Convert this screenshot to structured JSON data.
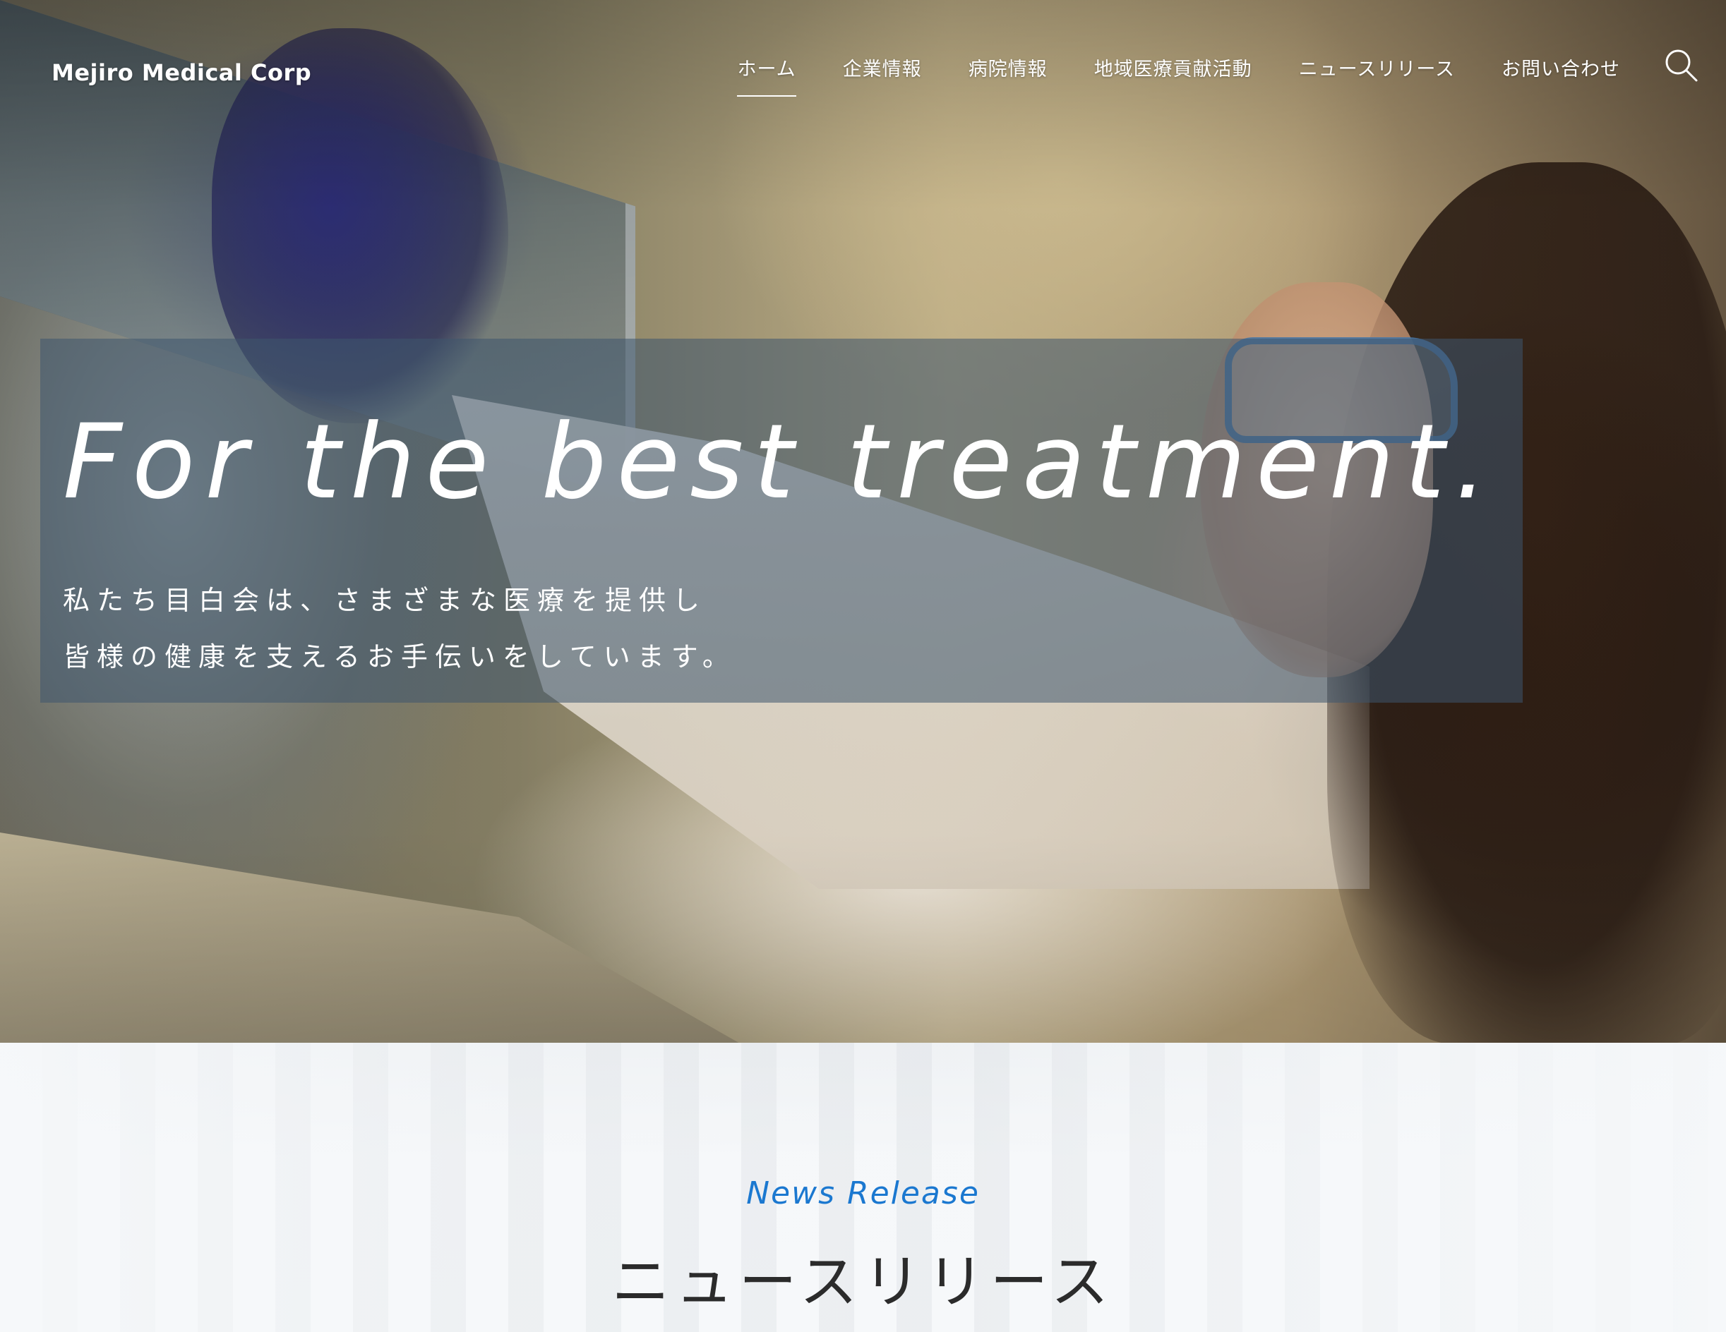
{
  "header": {
    "logo": "Mejiro Medical Corp",
    "nav": [
      {
        "label": "ホーム",
        "active": true
      },
      {
        "label": "企業情報",
        "active": false
      },
      {
        "label": "病院情報",
        "active": false
      },
      {
        "label": "地域医療貢献活動",
        "active": false
      },
      {
        "label": "ニュースリリース",
        "active": false
      },
      {
        "label": "お問い合わせ",
        "active": false
      }
    ],
    "search_icon": "search-icon"
  },
  "hero": {
    "title": "For the best treatment.",
    "subtitle_line1": "私たち目白会は、さまざまな医療を提供し",
    "subtitle_line2": "皆様の健康を支えるお手伝いをしています。"
  },
  "news": {
    "label_en": "News Release",
    "heading": "ニュースリリース"
  },
  "colors": {
    "accent": "#1b78d0",
    "heading_text": "#2b2b2b",
    "hero_text": "#ffffff"
  }
}
